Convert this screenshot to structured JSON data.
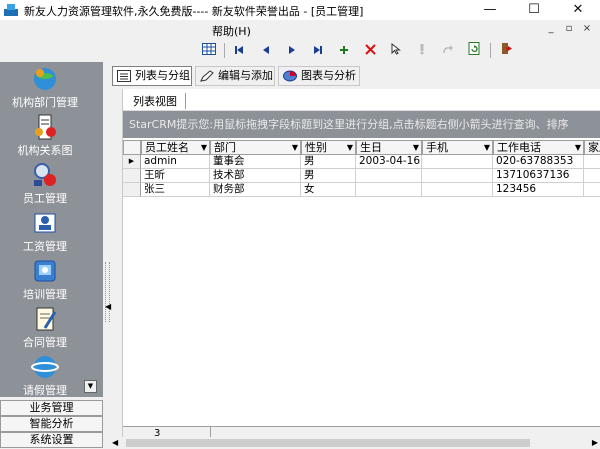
{
  "window": {
    "title": "新友人力资源管理软件,永久免费版---- 新友软件荣誉出品 - [员工管理]",
    "minimize_glyph": "—",
    "maximize_glyph": "☐",
    "close_glyph": "✕"
  },
  "menu": {
    "help_label": "帮助(H)",
    "mdi_minimize": "_",
    "mdi_restore": "▫",
    "mdi_close": "×"
  },
  "toolbar": {
    "icons": [
      "grid-icon",
      "first-record-icon",
      "prev-record-icon",
      "next-record-icon",
      "last-record-icon",
      "add-icon",
      "delete-icon",
      "pointer-icon",
      "lock-icon",
      "redo-icon",
      "refresh-icon",
      "exit-icon"
    ]
  },
  "leftnav": {
    "items": [
      {
        "label": "机构部门管理",
        "icon": "globe-org-icon"
      },
      {
        "label": "机构关系图",
        "icon": "org-chart-icon"
      },
      {
        "label": "员工管理",
        "icon": "employee-search-icon"
      },
      {
        "label": "工资管理",
        "icon": "salary-icon"
      },
      {
        "label": "培训管理",
        "icon": "training-icon"
      },
      {
        "label": "合同管理",
        "icon": "contract-icon"
      },
      {
        "label": "请假管理",
        "icon": "leave-icon"
      }
    ],
    "categories": [
      "业务管理",
      "智能分析",
      "系统设置"
    ],
    "scroll_glyph": "▼"
  },
  "tabs": [
    {
      "label": "列表与分组",
      "icon": "list-icon",
      "active": true
    },
    {
      "label": "编辑与添加",
      "icon": "edit-icon",
      "active": false
    },
    {
      "label": "图表与分析",
      "icon": "chart-icon",
      "active": false
    }
  ],
  "subtab": {
    "label": "列表视图"
  },
  "group_hint": "StarCRM提示您:用鼠标拖拽字段标题到这里进行分组,点击标题右侧小箭头进行查询、排序",
  "grid": {
    "columns": [
      "员工姓名",
      "部门",
      "性别",
      "生日",
      "手机",
      "工作电话",
      "家庭"
    ],
    "rows": [
      [
        "admin",
        "董事会",
        "男",
        "2003-04-16",
        "",
        "020-63788353",
        ""
      ],
      [
        "王昕",
        "技术部",
        "男",
        "",
        "",
        "13710637136",
        ""
      ],
      [
        "张三",
        "财务部",
        "女",
        "",
        "",
        "123456",
        ""
      ]
    ],
    "current_row_marker": "▶",
    "record_count": "3"
  },
  "scroll": {
    "left_arrow": "◀",
    "right_arrow": "▶"
  }
}
